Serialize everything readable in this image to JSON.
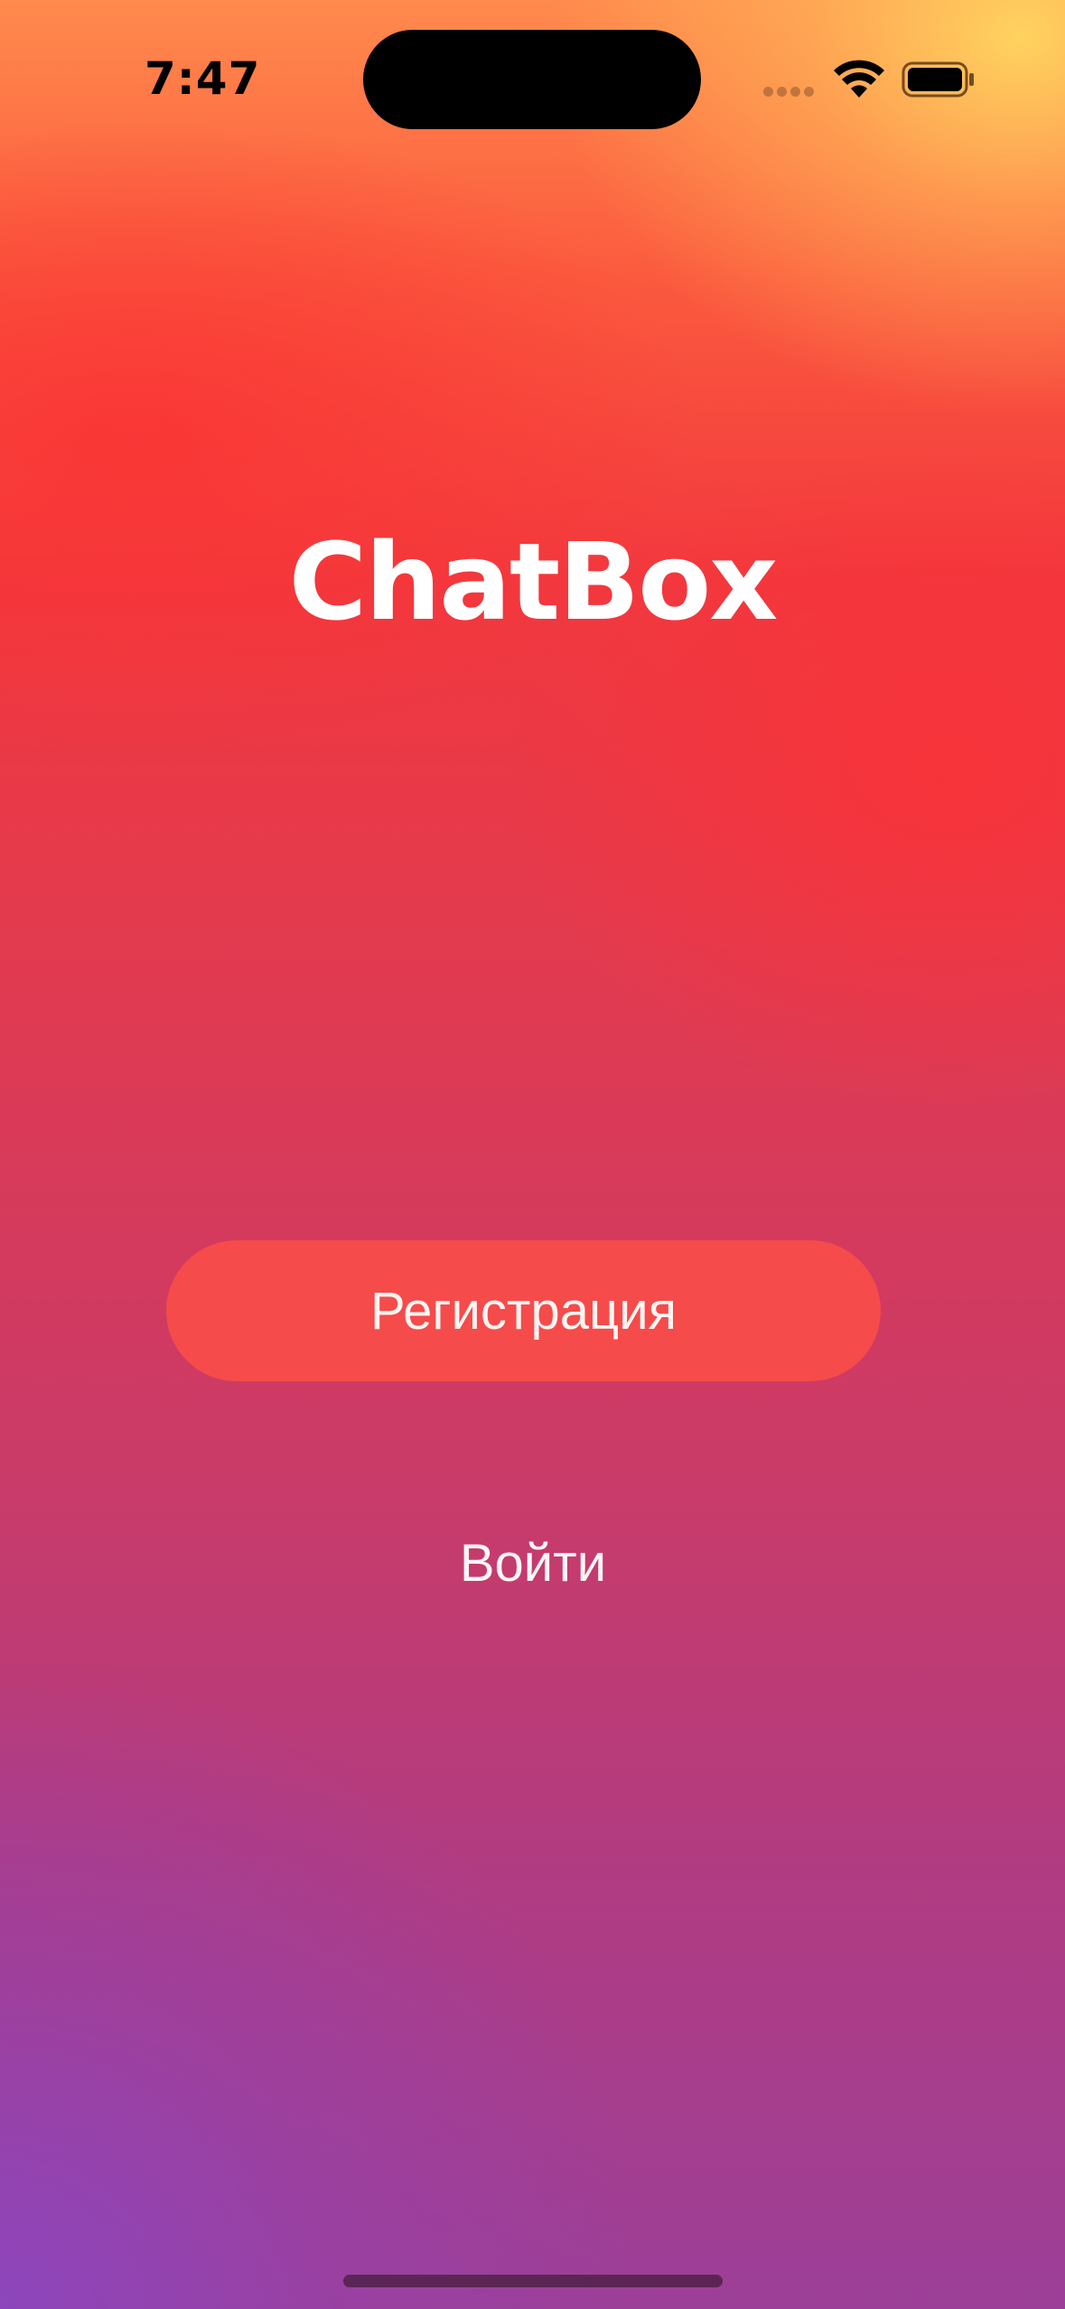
{
  "status_bar": {
    "time": "7:47"
  },
  "icons": {
    "wifi": "wifi-icon",
    "battery": "battery-icon",
    "signal": "signal-dots-icon"
  },
  "app": {
    "title": "ChatBox"
  },
  "actions": {
    "register_label": "Регистрация",
    "login_label": "Войти"
  },
  "colors": {
    "button_background": "#f64b4b",
    "text": "#ffffff",
    "gradient_top": "#ffd660",
    "gradient_middle": "#f2383e",
    "gradient_bottom": "#8c46be"
  }
}
